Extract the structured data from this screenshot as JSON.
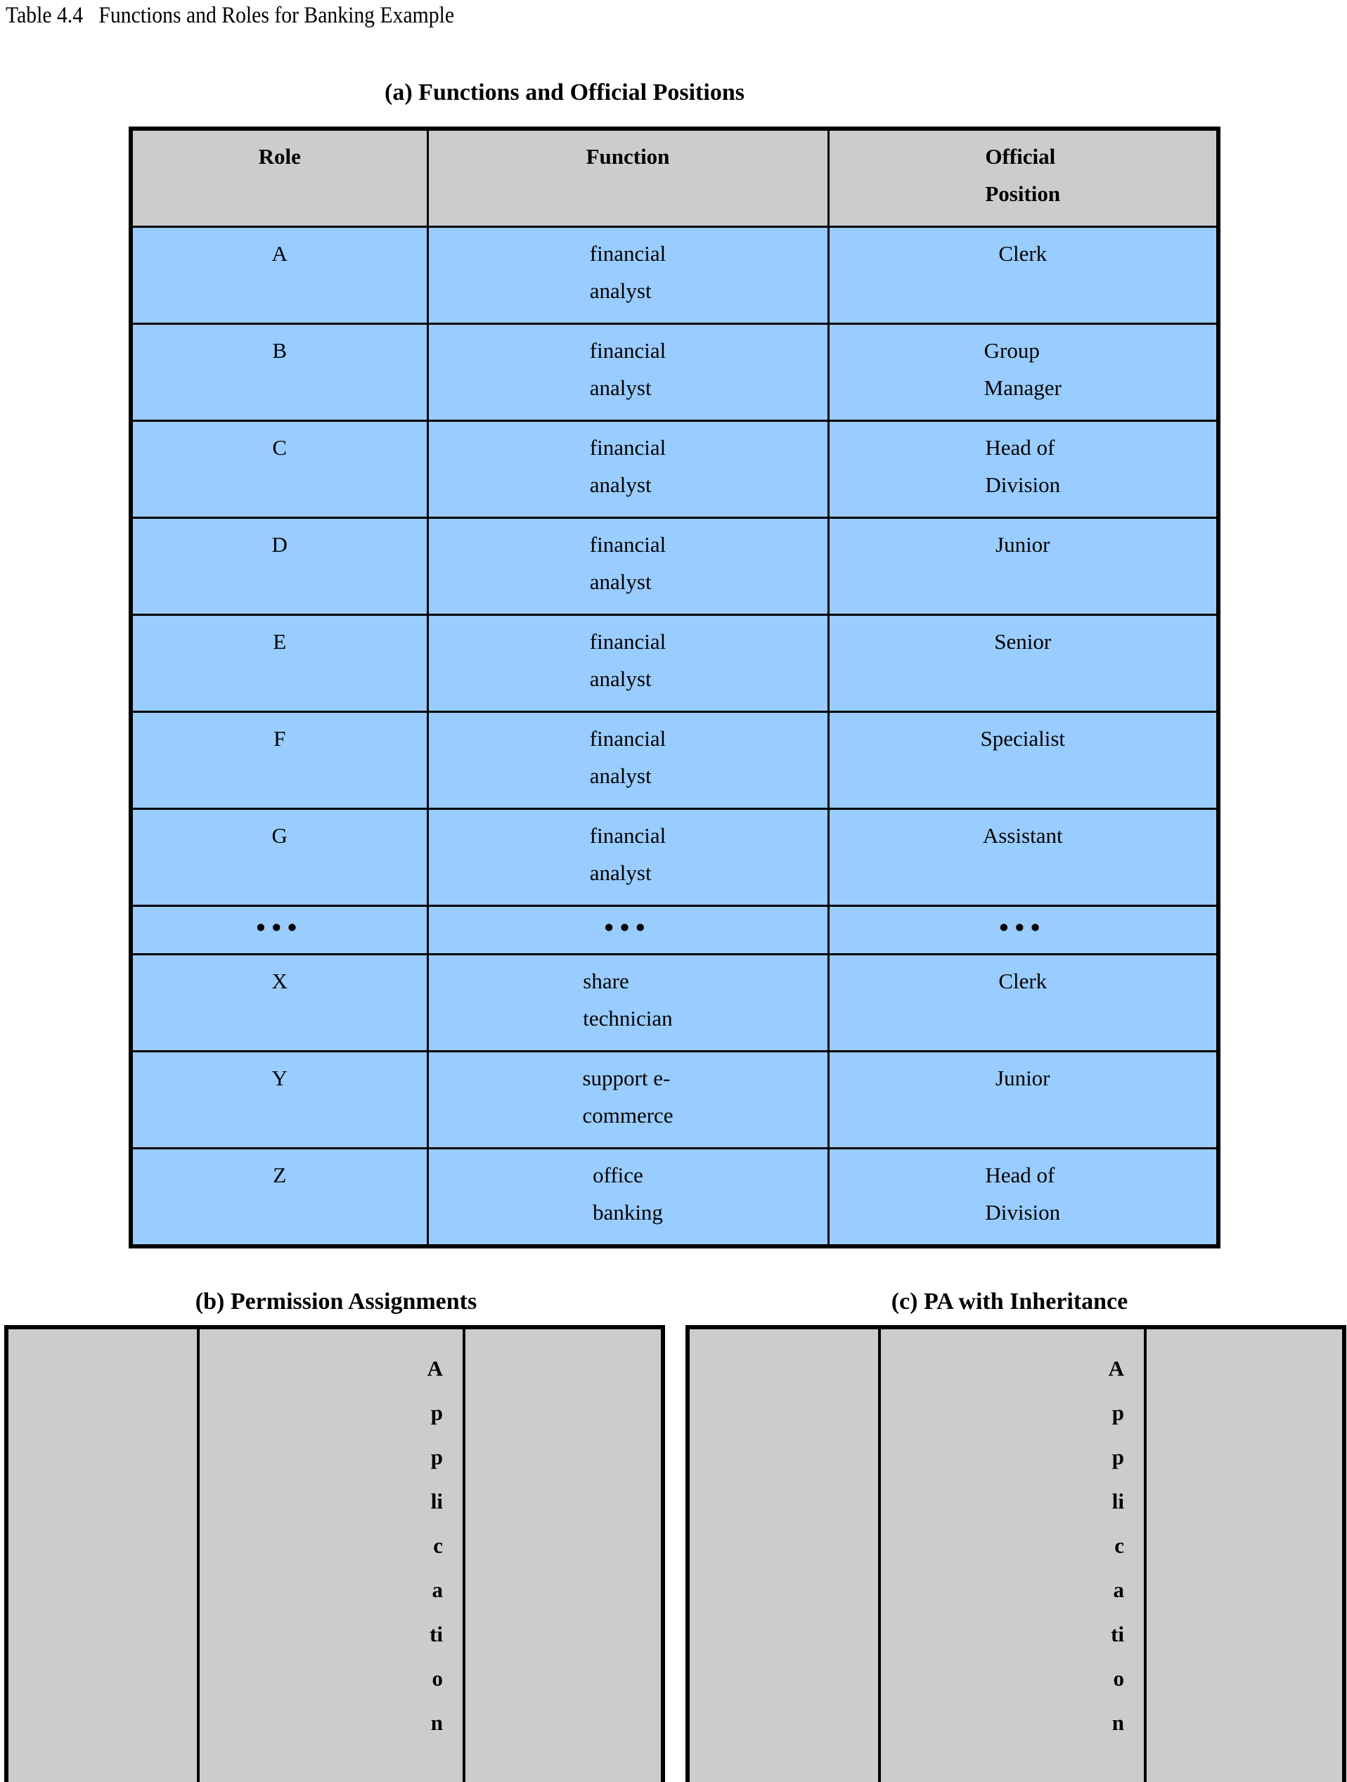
{
  "table_caption": "Table 4.4   Functions and Roles for Banking Example",
  "section_a": {
    "caption": "(a) Functions and Official Positions",
    "columns": [
      "Role",
      "Function",
      "Official\nPosition"
    ],
    "rows": [
      {
        "role": "A",
        "function": "financial\nanalyst",
        "position": "Clerk"
      },
      {
        "role": "B",
        "function": "financial\nanalyst",
        "position": "Group\nManager"
      },
      {
        "role": "C",
        "function": "financial\nanalyst",
        "position": "Head of\nDivision"
      },
      {
        "role": "D",
        "function": "financial\nanalyst",
        "position": "Junior"
      },
      {
        "role": "E",
        "function": "financial\nanalyst",
        "position": "Senior"
      },
      {
        "role": "F",
        "function": "financial\nanalyst",
        "position": "Specialist"
      },
      {
        "role": "G",
        "function": "financial\nanalyst",
        "position": "Assistant"
      },
      {
        "role": "•••",
        "function": "•••",
        "position": "•••"
      },
      {
        "role": "X",
        "function": "share\ntechnician",
        "position": "Clerk"
      },
      {
        "role": "Y",
        "function": "support e-\ncommerce",
        "position": "Junior"
      },
      {
        "role": "Z",
        "function": "office\nbanking",
        "position": "Head of\nDivision"
      }
    ]
  },
  "section_b": {
    "caption": "(b) Permission Assignments",
    "vertical_label": "A\np\np\nli\nc\na\nti\no\nn"
  },
  "section_c": {
    "caption": "(c) PA with Inheritance",
    "vertical_label": "A\np\np\nli\nc\na\nti\no\nn"
  },
  "colors": {
    "header_gray": "#cccccc",
    "cell_blue": "#99ccff",
    "border_black": "#000000",
    "page_background": "#ffffff"
  }
}
